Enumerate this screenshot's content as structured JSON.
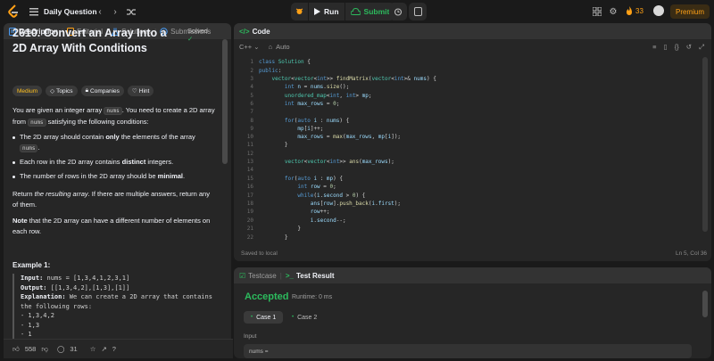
{
  "nav": {
    "title": "Daily Question",
    "run_label": "Run",
    "submit_label": "Submit",
    "streak": "33",
    "premium_label": "Premium"
  },
  "left_tabs": [
    "Description",
    "Editorial",
    "Solutions",
    "Submissions"
  ],
  "problem": {
    "title": "2610. Convert an Array Into a 2D Array With Conditions",
    "status": "Solved",
    "difficulty": "Medium",
    "tags": [
      "Topics",
      "Companies",
      "Hint"
    ],
    "intro_1": "You are given an integer array",
    "intro_code": "nums",
    "intro_2": ". You need to create a 2D array from",
    "intro_3": "satisfying the following conditions:",
    "bullet_1a": "The 2D array should contain",
    "bullet_1b": "only",
    "bullet_1c": "the elements of the array",
    "bullet_1d": ".",
    "bullet_2a": "Each row in the 2D array contains",
    "bullet_2b": "distinct",
    "bullet_2c": "integers.",
    "bullet_3a": "The number of rows in the 2D array should be",
    "bullet_3b": "minimal",
    "bullet_3c": ".",
    "return_a": "Return",
    "return_b": "the resulting array",
    "return_c": ". If there are multiple answers, return any of them.",
    "note_a": "Note",
    "note_b": "that the 2D array can have a different number of elements on each row.",
    "example_title": "Example 1:",
    "example_input_label": "Input:",
    "example_input": "nums = [1,3,4,1,2,3,1]",
    "example_output_label": "Output:",
    "example_output": "[[1,3,4,2],[1,3],[1]]",
    "example_expl_label": "Explanation:",
    "example_expl": "We can create a 2D array that contains the following rows:",
    "example_rows": [
      "- 1,3,4,2",
      "- 1,3",
      "- 1"
    ]
  },
  "left_footer": {
    "likes": "558",
    "comments": "31"
  },
  "code_panel": {
    "tab": "Code",
    "language": "C++",
    "mode": "Auto",
    "saved": "Saved to local",
    "cursor": "Ln 5, Col 36",
    "line_numbers": [
      "1",
      "2",
      "3",
      "4",
      "5",
      "6",
      "7",
      "8",
      "9",
      "10",
      "11",
      "12",
      "13",
      "14",
      "15",
      "16",
      "17",
      "18",
      "19",
      "20",
      "21",
      "22"
    ]
  },
  "result_panel": {
    "tab_testcase": "Testcase",
    "tab_result": "Test Result",
    "verdict": "Accepted",
    "runtime": "Runtime: 0 ms",
    "cases": [
      "Case 1",
      "Case 2"
    ],
    "input_label": "Input",
    "input_value": "nums ="
  },
  "colors": {
    "accent": "#ffa116",
    "accepted": "#2cbb5d",
    "medium": "#ffc01e"
  }
}
